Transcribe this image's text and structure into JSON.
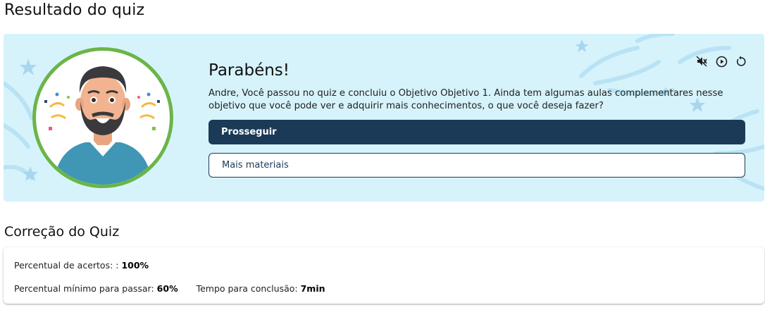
{
  "page": {
    "title": "Resultado do quiz"
  },
  "result": {
    "heading": "Parabéns!",
    "message": "Andre, Você passou no quiz e concluiu o Objetivo Objetivo 1. Ainda tem algumas aulas complementares nesse objetivo que você pode ver e adquirir mais conhecimentos, o que você deseja fazer?",
    "primary_button": "Prosseguir",
    "secondary_button": "Mais materiais",
    "controls": [
      "mute-icon",
      "play-icon",
      "replay-icon"
    ]
  },
  "correction": {
    "title": "Correção do Quiz",
    "accuracy_label": "Percentual de acertos: :",
    "accuracy_value": "100%",
    "min_label": "Percentual mínimo para passar:",
    "min_value": "60%",
    "time_label": "Tempo para conclusão:",
    "time_value": "7min"
  },
  "colors": {
    "hero_bg": "#d6f3fb",
    "primary": "#1a3a57",
    "avatar_ring": "#6bb547"
  }
}
